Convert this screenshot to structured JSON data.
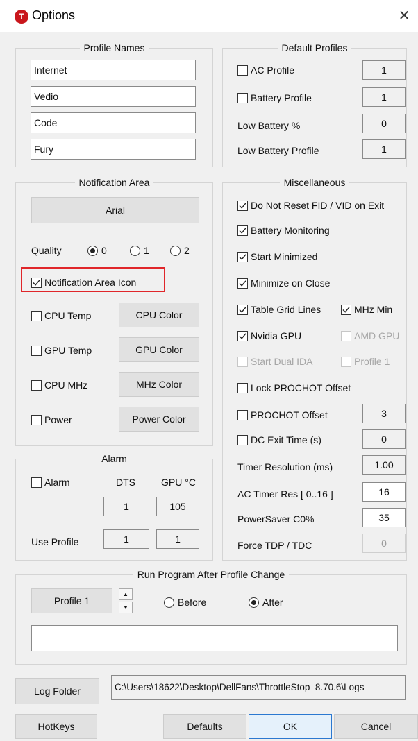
{
  "window": {
    "title": "Options",
    "logo_letter": "T",
    "close_symbol": "✕"
  },
  "profile_names": {
    "title": "Profile Names",
    "names": [
      "Internet",
      "Vedio",
      "Code",
      "Fury"
    ]
  },
  "default_profiles": {
    "title": "Default Profiles",
    "ac_profile": {
      "label": "AC Profile",
      "checked": false,
      "value": "1"
    },
    "battery_profile": {
      "label": "Battery Profile",
      "checked": false,
      "value": "1"
    },
    "low_battery_pct": {
      "label": "Low Battery %",
      "value": "0"
    },
    "low_battery_profile": {
      "label": "Low Battery Profile",
      "value": "1"
    }
  },
  "notification_area": {
    "title": "Notification Area",
    "font_button": "Arial",
    "quality_label": "Quality",
    "quality_options": [
      "0",
      "1",
      "2"
    ],
    "quality_selected": "0",
    "notification_icon": {
      "label": "Notification Area Icon",
      "checked": true
    },
    "cpu_temp": {
      "label": "CPU Temp",
      "checked": false,
      "button": "CPU Color"
    },
    "gpu_temp": {
      "label": "GPU Temp",
      "checked": false,
      "button": "GPU Color"
    },
    "cpu_mhz": {
      "label": "CPU MHz",
      "checked": false,
      "button": "MHz Color"
    },
    "power": {
      "label": "Power",
      "checked": false,
      "button": "Power Color"
    }
  },
  "alarm": {
    "title": "Alarm",
    "alarm_label": "Alarm",
    "alarm_checked": false,
    "dts_label": "DTS",
    "gpu_label": "GPU °C",
    "dts_value": "1",
    "gpu_value": "105",
    "use_profile_label": "Use Profile",
    "use_profile_dts": "1",
    "use_profile_gpu": "1"
  },
  "misc": {
    "title": "Miscellaneous",
    "do_not_reset": {
      "label": "Do Not Reset FID / VID on Exit",
      "checked": true
    },
    "battery_monitoring": {
      "label": "Battery Monitoring",
      "checked": true
    },
    "start_minimized": {
      "label": "Start Minimized",
      "checked": true
    },
    "minimize_on_close": {
      "label": "Minimize on Close",
      "checked": true
    },
    "table_grid_lines": {
      "label": "Table Grid Lines",
      "checked": true
    },
    "mhz_min": {
      "label": "MHz Min",
      "checked": true
    },
    "nvidia_gpu": {
      "label": "Nvidia GPU",
      "checked": true
    },
    "amd_gpu": {
      "label": "AMD GPU",
      "checked": false,
      "disabled": true
    },
    "start_dual_ida": {
      "label": "Start Dual IDA",
      "checked": false,
      "disabled": true
    },
    "profile_1": {
      "label": "Profile 1",
      "checked": false,
      "disabled": true
    },
    "lock_prochot": {
      "label": "Lock PROCHOT Offset",
      "checked": false
    },
    "prochot_offset": {
      "label": "PROCHOT Offset",
      "checked": false,
      "value": "3"
    },
    "dc_exit_time": {
      "label": "DC Exit Time (s)",
      "checked": false,
      "value": "0"
    },
    "timer_resolution": {
      "label": "Timer Resolution (ms)",
      "value": "1.00"
    },
    "ac_timer_res": {
      "label": "AC Timer Res [ 0..16 ]",
      "value": "16"
    },
    "powersaver_c0": {
      "label": "PowerSaver C0%",
      "value": "35"
    },
    "force_tdp": {
      "label": "Force TDP / TDC",
      "value": "0"
    }
  },
  "run_program": {
    "title": "Run Program After Profile Change",
    "profile_button": "Profile 1",
    "before_label": "Before",
    "after_label": "After",
    "selected": "After",
    "command": ""
  },
  "bottom": {
    "log_folder_button": "Log Folder",
    "log_path": "C:\\Users\\18622\\Desktop\\DellFans\\ThrottleStop_8.70.6\\Logs",
    "hotkeys_button": "HotKeys",
    "defaults_button": "Defaults",
    "ok_button": "OK",
    "cancel_button": "Cancel"
  }
}
